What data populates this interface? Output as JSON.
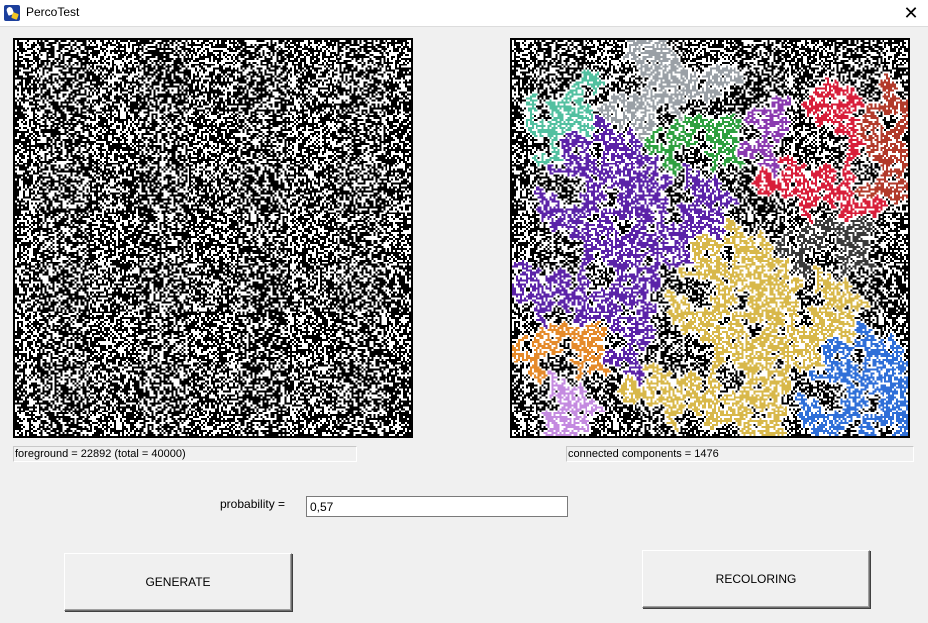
{
  "window": {
    "title": "PercoTest",
    "close_glyph": "✕",
    "icon": "percolation-app-icon"
  },
  "left_panel": {
    "status": "foreground = 22892 (total = 40000)",
    "grid_size": 200,
    "foreground_count": 22892,
    "total": 40000
  },
  "right_panel": {
    "status": "connected components = 1476",
    "components": 1476
  },
  "probability": {
    "label": "probability =",
    "value": "0,57"
  },
  "buttons": {
    "generate": "GENERATE",
    "recoloring": "RECOLORING"
  },
  "colors": {
    "foreground": "#000000",
    "background": "#ffffff",
    "clusters": [
      "#5b23a8",
      "#d8b84a",
      "#2f6fd8",
      "#d81e3a",
      "#9aa0a6",
      "#b23a2a",
      "#2fa040",
      "#3a3a3a",
      "#e58a2a",
      "#52c0a0",
      "#c48ae0",
      "#8a3ab0"
    ]
  }
}
